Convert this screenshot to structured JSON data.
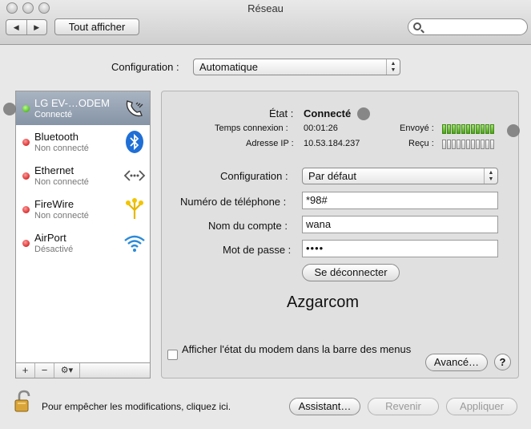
{
  "window": {
    "title": "Réseau"
  },
  "toolbar": {
    "back_label": "◀",
    "forward_label": "▶",
    "show_all_label": "Tout afficher",
    "search_value": ""
  },
  "location": {
    "label": "Configuration :",
    "value": "Automatique"
  },
  "services": [
    {
      "name": "LG EV-…ODEM",
      "status": "Connecté",
      "state": "connected",
      "icon": "modem-phone-icon"
    },
    {
      "name": "Bluetooth",
      "status": "Non connecté",
      "state": "disconnected",
      "icon": "bluetooth-icon"
    },
    {
      "name": "Ethernet",
      "status": "Non connecté",
      "state": "disconnected",
      "icon": "ethernet-icon"
    },
    {
      "name": "FireWire",
      "status": "Non connecté",
      "state": "disconnected",
      "icon": "firewire-icon"
    },
    {
      "name": "AirPort",
      "status": "Désactivé",
      "state": "disconnected",
      "icon": "wifi-icon"
    }
  ],
  "sidebar_actions": {
    "add_label": "+",
    "remove_label": "−",
    "gear_label": "⚙▾"
  },
  "detail": {
    "state_label": "État :",
    "state_value": "Connecté",
    "connect_time_label": "Temps connexion :",
    "connect_time_value": "00:01:26",
    "ip_label": "Adresse IP :",
    "ip_value": "10.53.184.237",
    "sent_label": "Envoyé :",
    "received_label": "Reçu :",
    "sent_level": 1.0,
    "received_level": 0.0,
    "config_label": "Configuration :",
    "config_value": "Par défaut",
    "phone_label": "Numéro de téléphone :",
    "phone_value": "*98#",
    "account_label": "Nom du compte :",
    "account_value": "wana",
    "password_label": "Mot de passe :",
    "password_value": "••••",
    "disconnect_label": "Se déconnecter",
    "provider_name": "Azgarcom",
    "show_modem_status_label": "Afficher l'état du modem dans la barre des menus",
    "advanced_label": "Avancé…",
    "help_label": "?"
  },
  "footer": {
    "lock_text": "Pour empêcher les modifications, cliquez ici.",
    "assistant_label": "Assistant…",
    "revert_label": "Revenir",
    "apply_label": "Appliquer"
  },
  "colors": {
    "connected": "#2da000",
    "disconnected": "#c80000",
    "selection": "#8694a6"
  }
}
